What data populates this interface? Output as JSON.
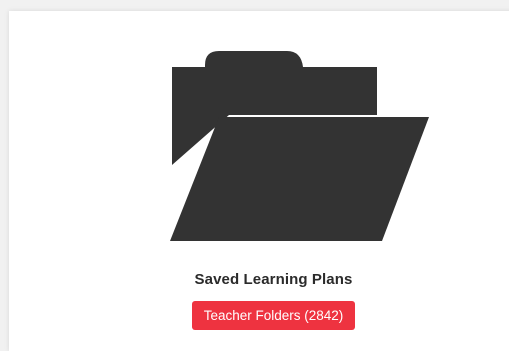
{
  "colors": {
    "page_background": "#f1f1f1",
    "card_background": "#ffffff",
    "icon_fill": "#333333",
    "badge_background": "#ee3340",
    "badge_text": "#ffffff"
  },
  "card": {
    "icon": "folder-open-icon",
    "title": "Saved Learning Plans",
    "badge_label": "Teacher Folders (2842)"
  }
}
